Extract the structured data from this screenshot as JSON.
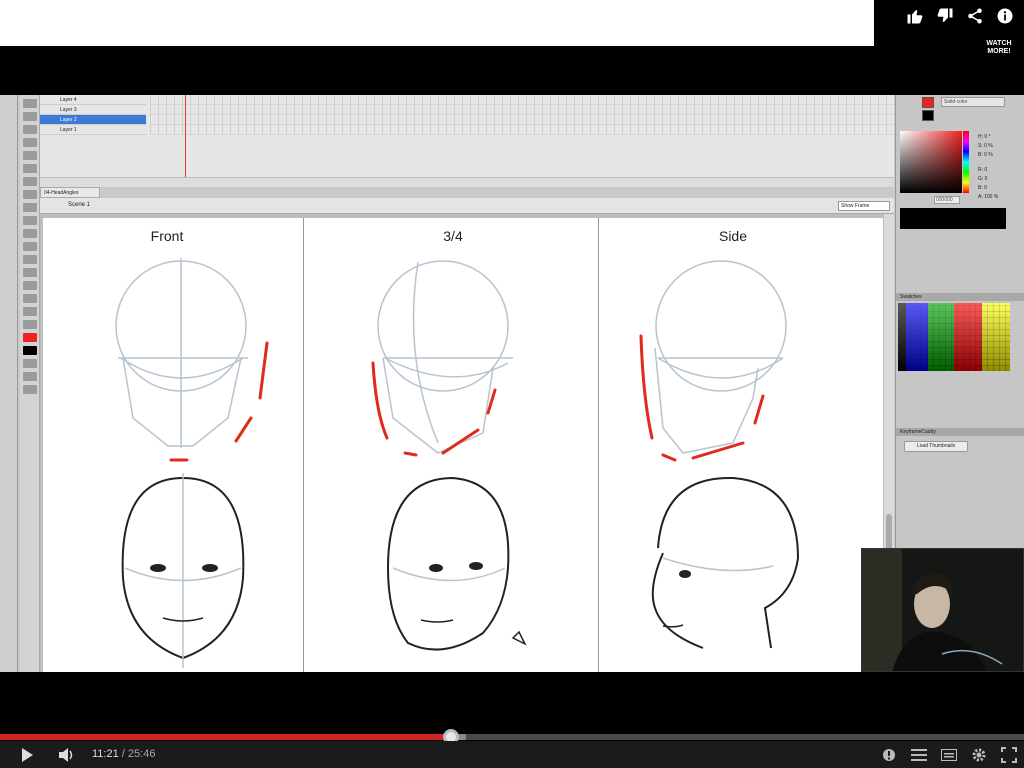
{
  "top_actions": {
    "like_icon": "thumbs-up-icon",
    "dislike_icon": "thumbs-down-icon",
    "share_icon": "share-icon",
    "info_icon": "info-icon",
    "watch_more": "WATCH MORE!"
  },
  "flash": {
    "layers": [
      "Layer 4",
      "Layer 3",
      "Layer 2",
      "Layer 1"
    ],
    "selected_layer": "Layer 2",
    "document_tab": "04-HeadAngles",
    "scene": "Scene 1",
    "show_frame": "Show Frame",
    "color_panel": {
      "fill_type": "Solid color",
      "stroke_color": "#e22222",
      "fill_color": "#000000",
      "hex": "000000",
      "h_label": "H: 0 °",
      "s_label": "S: 0 %",
      "b_label": "B: 0 %",
      "r_label": "R: 0",
      "g_label": "G: 0",
      "b2_label": "B: 0",
      "alpha_label": "A: 100 %"
    },
    "swatches_title": "Swatches",
    "keyframecaddy_title": "KeyframeCaddy",
    "load_thumbnails": "Load Thumbnails",
    "columns": [
      "Front",
      "3/4",
      "Side"
    ]
  },
  "player": {
    "current_time": "11:21",
    "separator": "/",
    "duration": "25:46",
    "progress_fraction": 0.4406,
    "accent": "#d42323"
  }
}
